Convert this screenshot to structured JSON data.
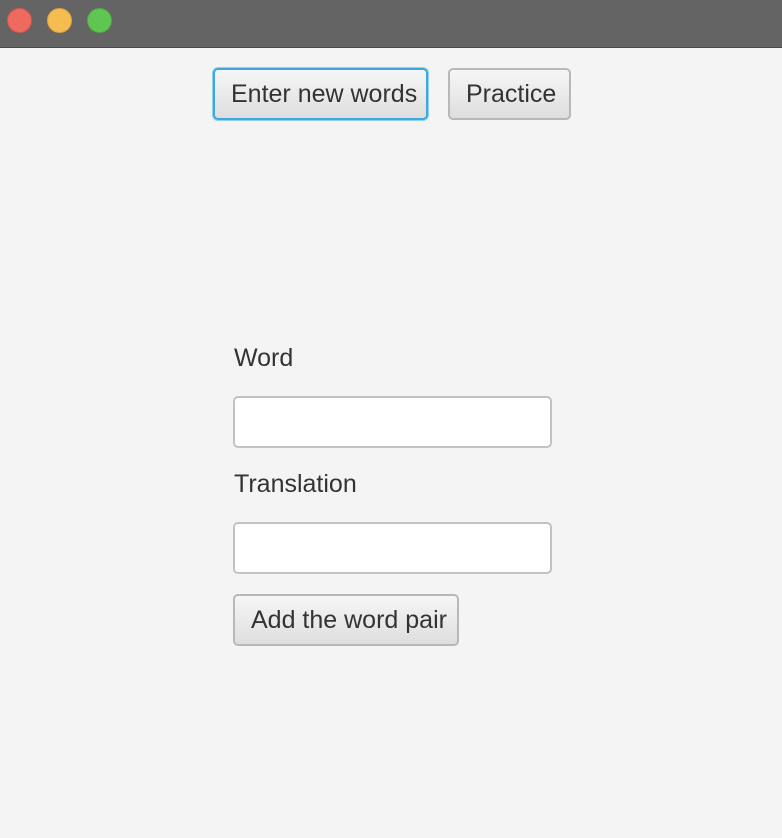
{
  "window": {
    "controls": [
      "close-icon",
      "minimize-icon",
      "zoom-icon"
    ],
    "colors": {
      "close": "#ee6a5f",
      "minimize": "#f5bd4f",
      "zoom": "#61c554"
    }
  },
  "toolbar": {
    "enter_new_words_label": "Enter new words",
    "practice_label": "Practice"
  },
  "form": {
    "word_label": "Word",
    "word_value": "",
    "translation_label": "Translation",
    "translation_value": "",
    "add_button_label": "Add the word pair"
  },
  "colors": {
    "focus_accent": "#3ea8de",
    "background": "#f4f4f4",
    "titlebar": "#646464"
  }
}
